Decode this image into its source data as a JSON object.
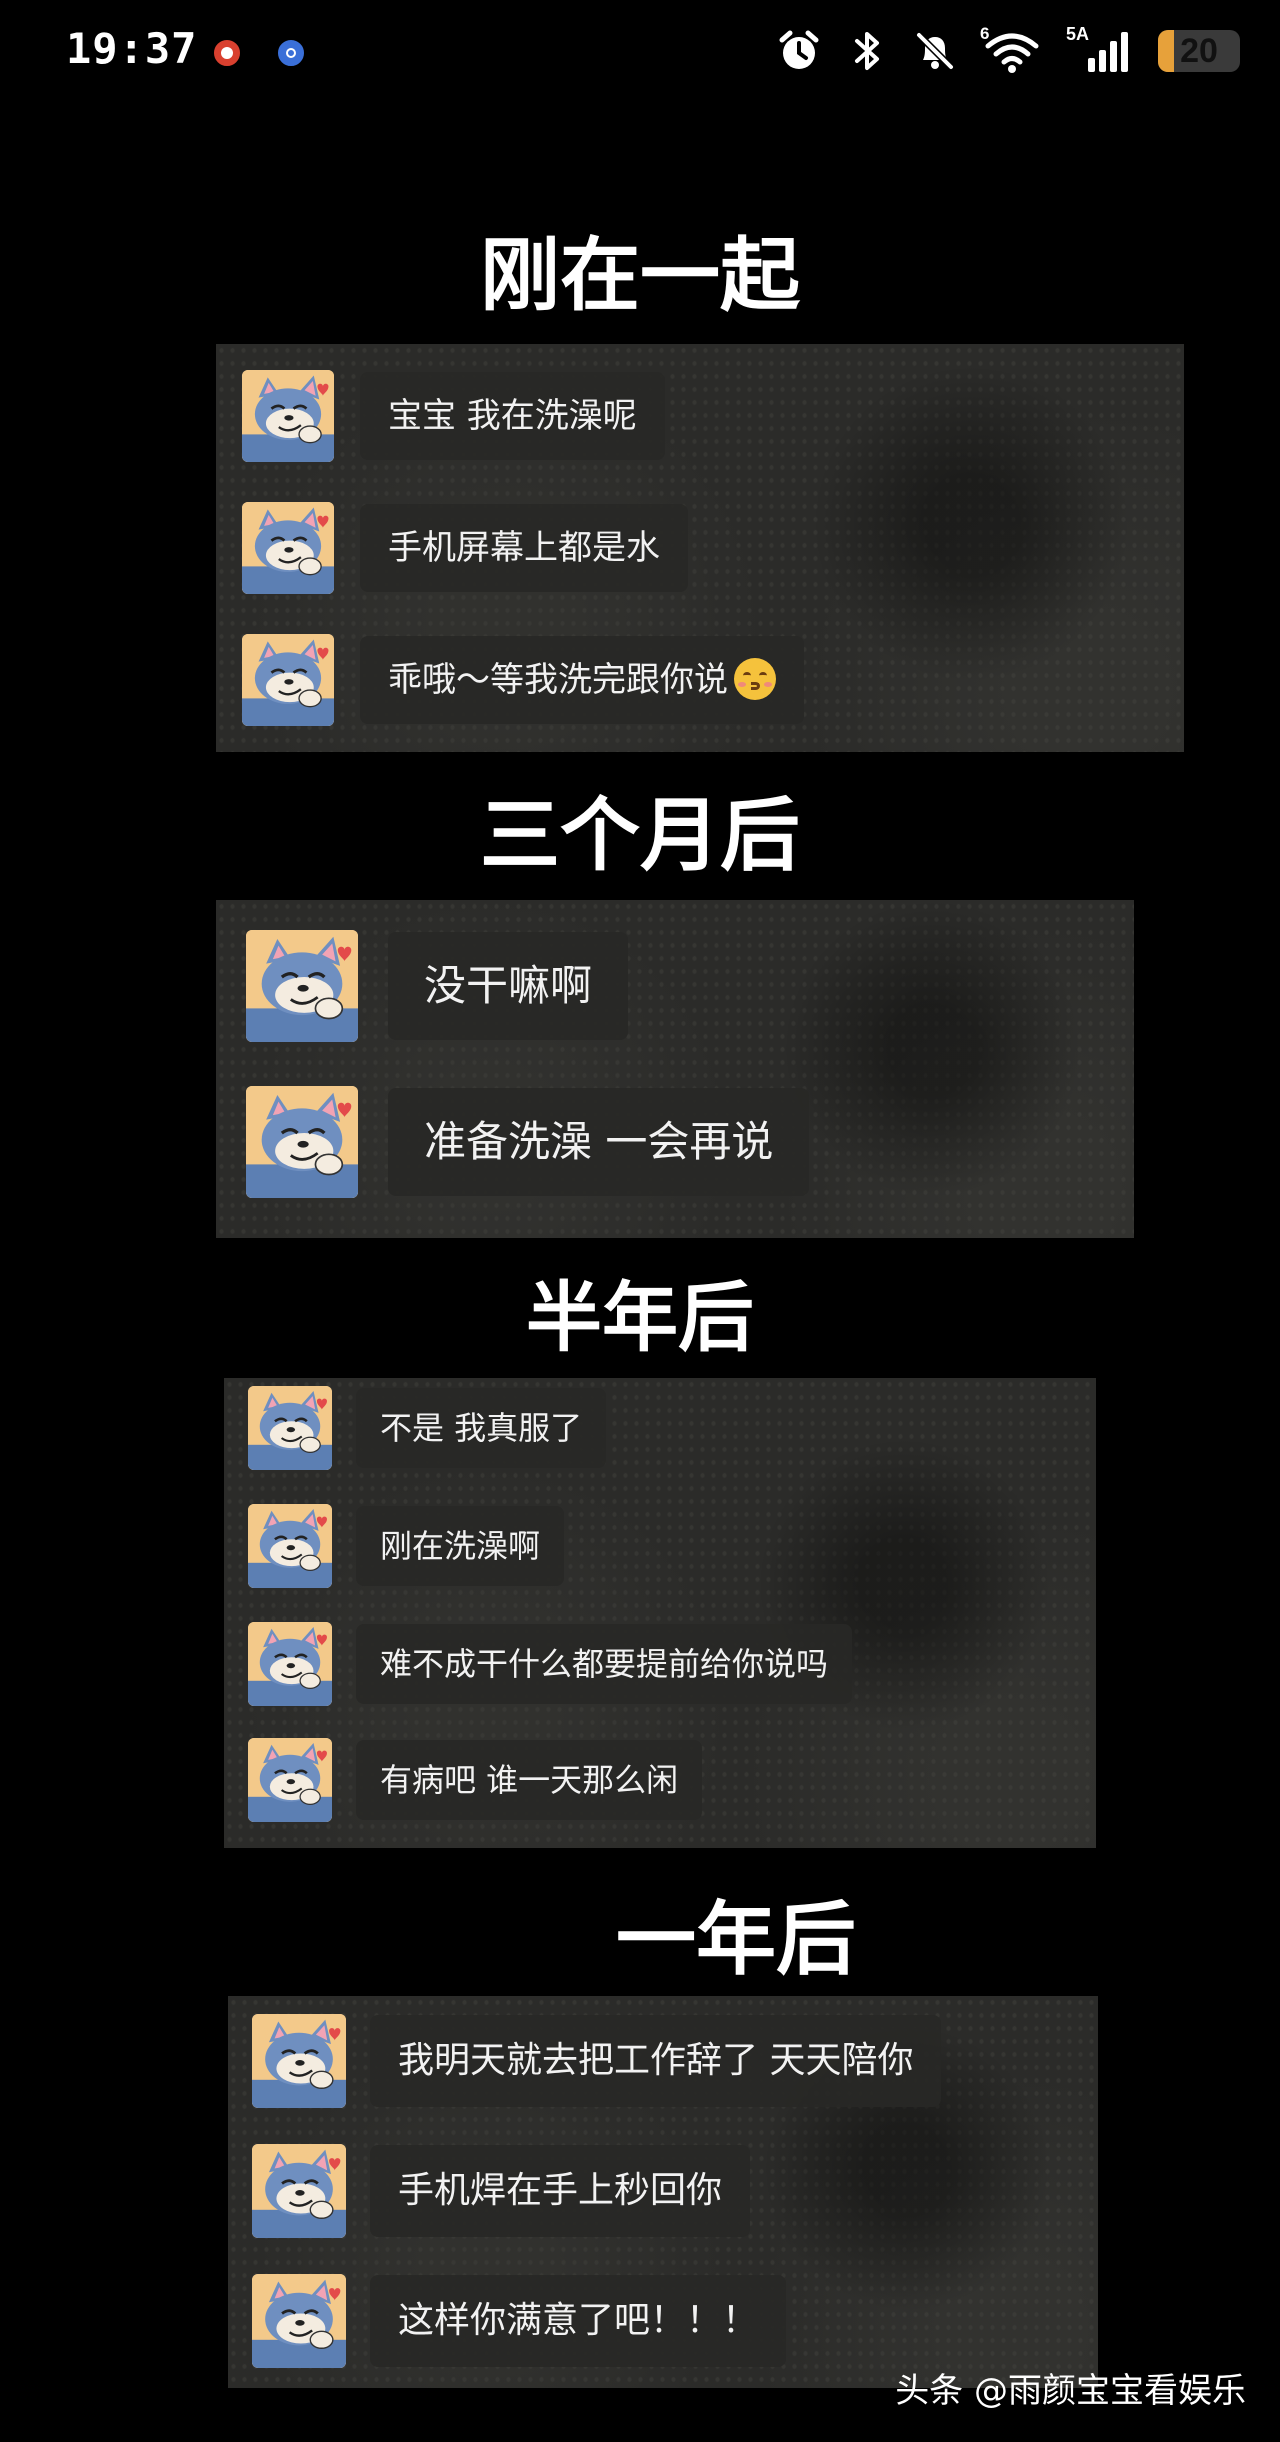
{
  "status_bar": {
    "time": "19:37",
    "network_badge_6": "6",
    "network_badge_5a": "5A",
    "battery_level": "20",
    "battery_percent": 20,
    "icons": [
      "app-notification-icon",
      "app-notification-icon",
      "alarm-icon",
      "bluetooth-icon",
      "bell-muted-icon",
      "wifi-icon",
      "cellular-signal-icon",
      "battery-icon"
    ],
    "accent_battery": "#e7a13a"
  },
  "sections": [
    {
      "title": "刚在一起",
      "messages": [
        "宝宝 我在洗澡呢",
        "手机屏幕上都是水",
        "乖哦～等我洗完跟你说"
      ],
      "emoji_after_last": "kissing-face-emoji"
    },
    {
      "title": "三个月后",
      "messages": [
        "没干嘛啊",
        "准备洗澡 一会再说"
      ]
    },
    {
      "title": "半年后",
      "messages": [
        "不是 我真服了",
        "刚在洗澡啊",
        "难不成干什么都要提前给你说吗",
        "有病吧 谁一天那么闲"
      ]
    },
    {
      "title": "一年后",
      "messages": [
        "我明天就去把工作辞了 天天陪你",
        "手机焊在手上秒回你",
        "这样你满意了吧！！！"
      ]
    }
  ],
  "watermark": "头条 @雨颜宝宝看娱乐",
  "colors": {
    "background": "#000000",
    "panel": "#2b2b29",
    "bubble": "#282826",
    "avatar_bg": "#f3c98a",
    "cat_blue": "#6f8fc0"
  }
}
